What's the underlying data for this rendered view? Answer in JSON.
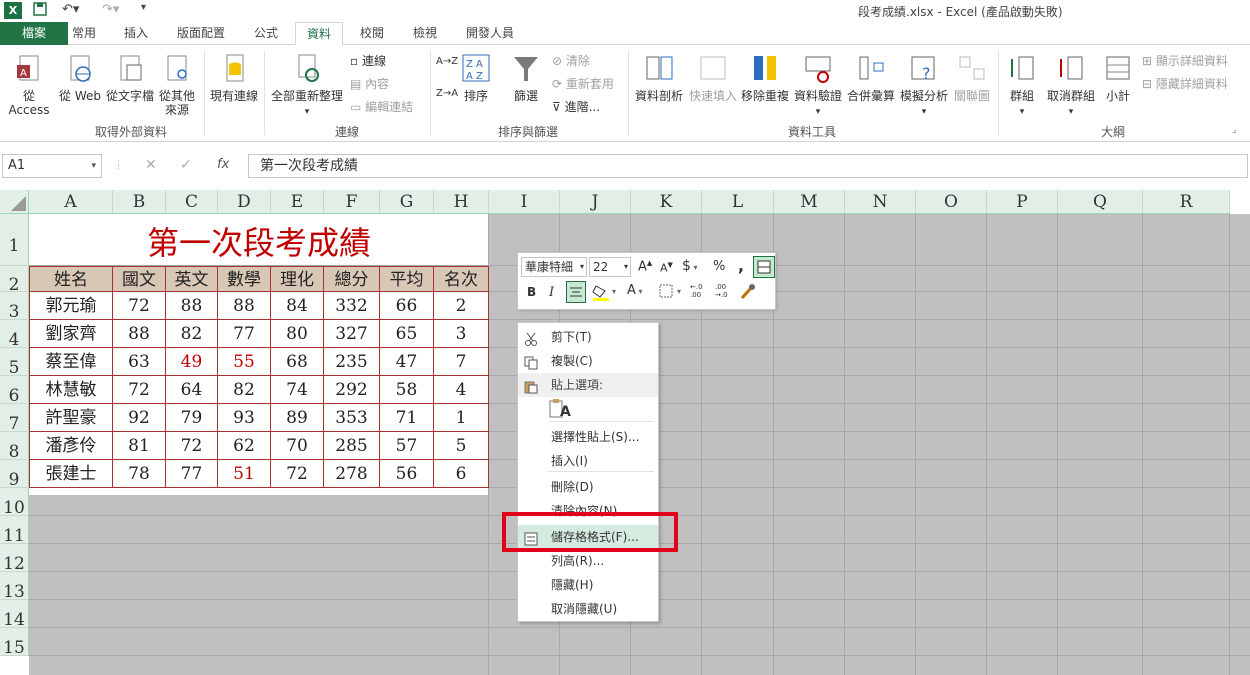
{
  "title": {
    "app_icon": "X",
    "text": "段考成績.xlsx - Excel (產品啟動失敗)"
  },
  "tabs": [
    {
      "label": "檔案"
    },
    {
      "label": "常用"
    },
    {
      "label": "插入"
    },
    {
      "label": "版面配置"
    },
    {
      "label": "公式"
    },
    {
      "label": "資料",
      "active": true
    },
    {
      "label": "校閱"
    },
    {
      "label": "檢視"
    },
    {
      "label": "開發人員"
    }
  ],
  "ribbon": {
    "groups": [
      {
        "label": "取得外部資料"
      },
      {
        "label": "連線"
      },
      {
        "label": "排序與篩選"
      },
      {
        "label": "資料工具"
      },
      {
        "label": "大綱"
      }
    ],
    "btn_access": "從 Access",
    "btn_web": "從 Web",
    "btn_text": "從文字檔",
    "btn_other1": "從其他",
    "btn_other2": "來源",
    "btn_existing": "現有連線",
    "btn_refresh": "全部重新整理",
    "conn_links": "連線",
    "conn_props": "內容",
    "conn_edit": "編輯連結",
    "sort_az": "A→Z",
    "sort_za": "Z→A",
    "btn_sort": "排序",
    "btn_filter": "篩選",
    "f_clear": "清除",
    "f_reapply": "重新套用",
    "f_advanced": "進階...",
    "btn_t2c": "資料剖析",
    "btn_flash": "快速填入",
    "btn_dup": "移除重複",
    "btn_valid": "資料驗證",
    "btn_consol": "合併彙算",
    "btn_whatif": "模擬分析",
    "btn_rel": "關聯圖",
    "btn_group": "群組",
    "btn_ungroup": "取消群組",
    "btn_subtotal": "小計",
    "show_detail": "顯示詳細資料",
    "hide_detail": "隱藏詳細資料"
  },
  "formula": {
    "namebox": "A1",
    "fx": "fx",
    "content": "第一次段考成績"
  },
  "sheet": {
    "columns": [
      "A",
      "B",
      "C",
      "D",
      "E",
      "F",
      "G",
      "H",
      "I",
      "J",
      "K",
      "L",
      "M",
      "N",
      "O",
      "P",
      "Q",
      "R"
    ],
    "rows": [
      "1",
      "2",
      "3",
      "4",
      "5",
      "6",
      "7",
      "8",
      "9",
      "10",
      "11",
      "12",
      "13",
      "14",
      "15"
    ],
    "title": "第一次段考成績",
    "headers": [
      "姓名",
      "國文",
      "英文",
      "數學",
      "理化",
      "總分",
      "平均",
      "名次"
    ],
    "data": [
      [
        "郭元瑜",
        "72",
        "88",
        "88",
        "84",
        "332",
        "66",
        "2"
      ],
      [
        "劉家齊",
        "88",
        "82",
        "77",
        "80",
        "327",
        "65",
        "3"
      ],
      [
        "蔡至偉",
        "63",
        "49",
        "55",
        "68",
        "235",
        "47",
        "7"
      ],
      [
        "林慧敏",
        "72",
        "64",
        "82",
        "74",
        "292",
        "58",
        "4"
      ],
      [
        "許聖豪",
        "92",
        "79",
        "93",
        "89",
        "353",
        "71",
        "1"
      ],
      [
        "潘彥伶",
        "81",
        "72",
        "62",
        "70",
        "285",
        "57",
        "5"
      ],
      [
        "張建士",
        "78",
        "77",
        "51",
        "72",
        "278",
        "56",
        "6"
      ]
    ],
    "failing_color": "#c00000"
  },
  "minitoolbar": {
    "font_name": "華康特細",
    "font_size": "22",
    "grow": "A",
    "shrink": "A",
    "currency": "$",
    "percent": "%",
    "comma": ",",
    "bold": "B",
    "italic": "I",
    "font_color_label": "A",
    "inc_dec": "←.0 .00",
    "dec_dec": ".00 →.0"
  },
  "context_menu": [
    {
      "label": "剪下(T)",
      "icon": "scissors-icon"
    },
    {
      "label": "複製(C)",
      "icon": "copy-icon"
    },
    {
      "label": "貼上選項:",
      "icon": "paste-icon"
    },
    {
      "label": "A",
      "icon": "paste-option-icon"
    },
    {
      "label": "選擇性貼上(S)...",
      "icon": ""
    },
    {
      "label": "插入(I)",
      "icon": ""
    },
    {
      "label": "刪除(D)",
      "icon": ""
    },
    {
      "label": "清除內容(N)",
      "icon": ""
    },
    {
      "label": "儲存格格式(F)...",
      "icon": "format-cells-icon"
    },
    {
      "label": "列高(R)...",
      "icon": ""
    },
    {
      "label": "隱藏(H)",
      "icon": ""
    },
    {
      "label": "取消隱藏(U)",
      "icon": ""
    }
  ],
  "colors": {
    "excel_green": "#217346",
    "header_fill": "#d9c7b6",
    "title_red": "#c00000",
    "highlight_red": "#e2001a"
  }
}
